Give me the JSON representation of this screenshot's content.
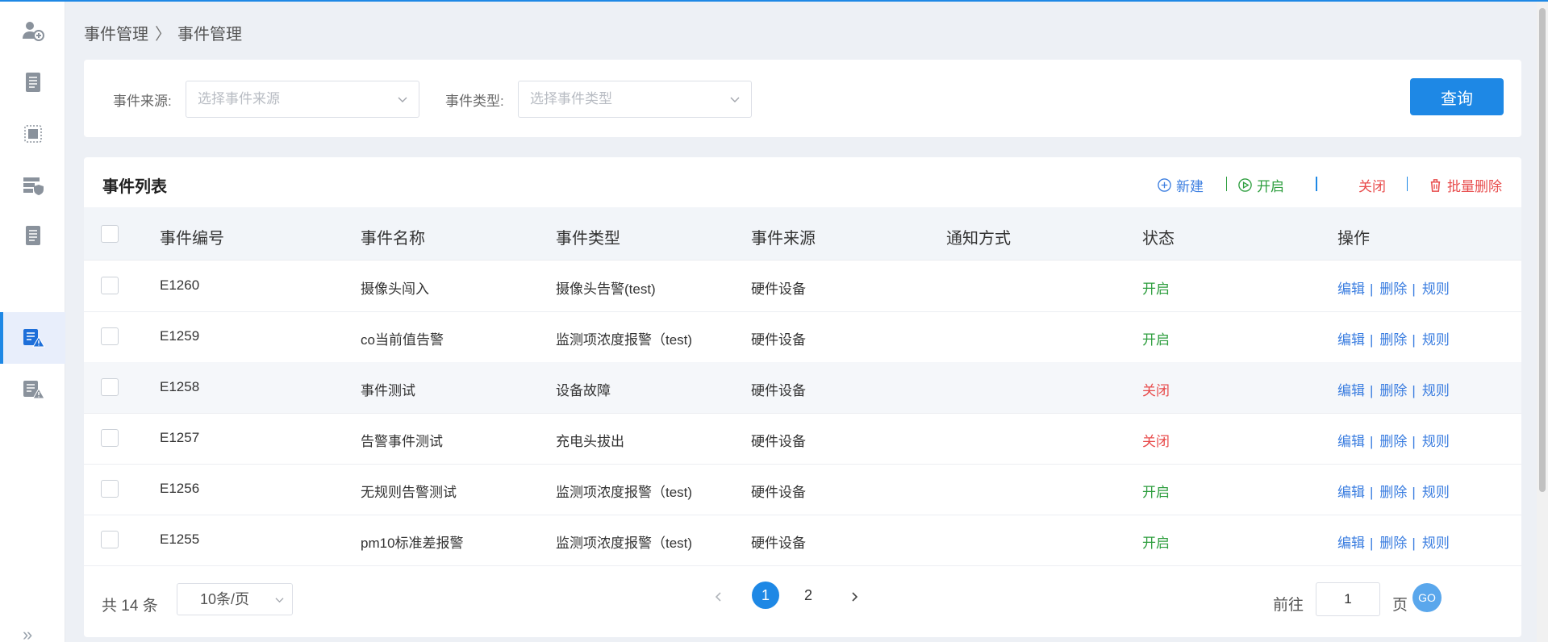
{
  "breadcrumb": {
    "parent": "事件管理",
    "separator": "〉",
    "current": "事件管理"
  },
  "sidebar": {
    "items": [
      {
        "icon": "user-add-icon"
      },
      {
        "icon": "document-list-icon"
      },
      {
        "icon": "chip-icon"
      },
      {
        "icon": "server-shield-icon"
      },
      {
        "icon": "document-list-icon"
      },
      {
        "icon": "event-alert-icon",
        "active": true
      },
      {
        "icon": "event-alert-icon"
      }
    ],
    "collapse": "»"
  },
  "filters": {
    "source_label": "事件来源:",
    "source_placeholder": "选择事件来源",
    "type_label": "事件类型:",
    "type_placeholder": "选择事件类型",
    "query_button": "查询"
  },
  "table_card": {
    "title": "事件列表",
    "actions": {
      "create": "新建",
      "enable": "开启",
      "disable": "关闭",
      "batch_delete": "批量删除"
    },
    "columns": [
      "事件编号",
      "事件名称",
      "事件类型",
      "事件来源",
      "通知方式",
      "状态",
      "操作"
    ],
    "row_actions": {
      "edit": "编辑",
      "delete": "删除",
      "rule": "规则",
      "separator": "|"
    },
    "rows": [
      {
        "id": "E1260",
        "name": "摄像头闯入",
        "type": "摄像头告警(test)",
        "source": "硬件设备",
        "notify": "",
        "status": "开启",
        "status_on": true
      },
      {
        "id": "E1259",
        "name": "co当前值告警",
        "type": "监测项浓度报警（test)",
        "source": "硬件设备",
        "notify": "",
        "status": "开启",
        "status_on": true
      },
      {
        "id": "E1258",
        "name": "事件测试",
        "type": "设备故障",
        "source": "硬件设备",
        "notify": "",
        "status": "关闭",
        "status_on": false
      },
      {
        "id": "E1257",
        "name": "告警事件测试",
        "type": "充电头拔出",
        "source": "硬件设备",
        "notify": "",
        "status": "关闭",
        "status_on": false
      },
      {
        "id": "E1256",
        "name": "无规则告警测试",
        "type": "监测项浓度报警（test)",
        "source": "硬件设备",
        "notify": "",
        "status": "开启",
        "status_on": true
      },
      {
        "id": "E1255",
        "name": "pm10标准差报警",
        "type": "监测项浓度报警（test)",
        "source": "硬件设备",
        "notify": "",
        "status": "开启",
        "status_on": true
      }
    ]
  },
  "pagination": {
    "total_text": "共 14 条",
    "page_size": "10条/页",
    "pages": [
      "1",
      "2"
    ],
    "current_page": "1",
    "goto_label": "前往",
    "goto_value": "1",
    "page_unit": "页",
    "go_button": "GO"
  },
  "colors": {
    "accent": "#1e88e5",
    "status_on": "#2e9e3f",
    "status_off": "#e84c4c",
    "link": "#3a7de0",
    "danger": "#e84c4c"
  }
}
